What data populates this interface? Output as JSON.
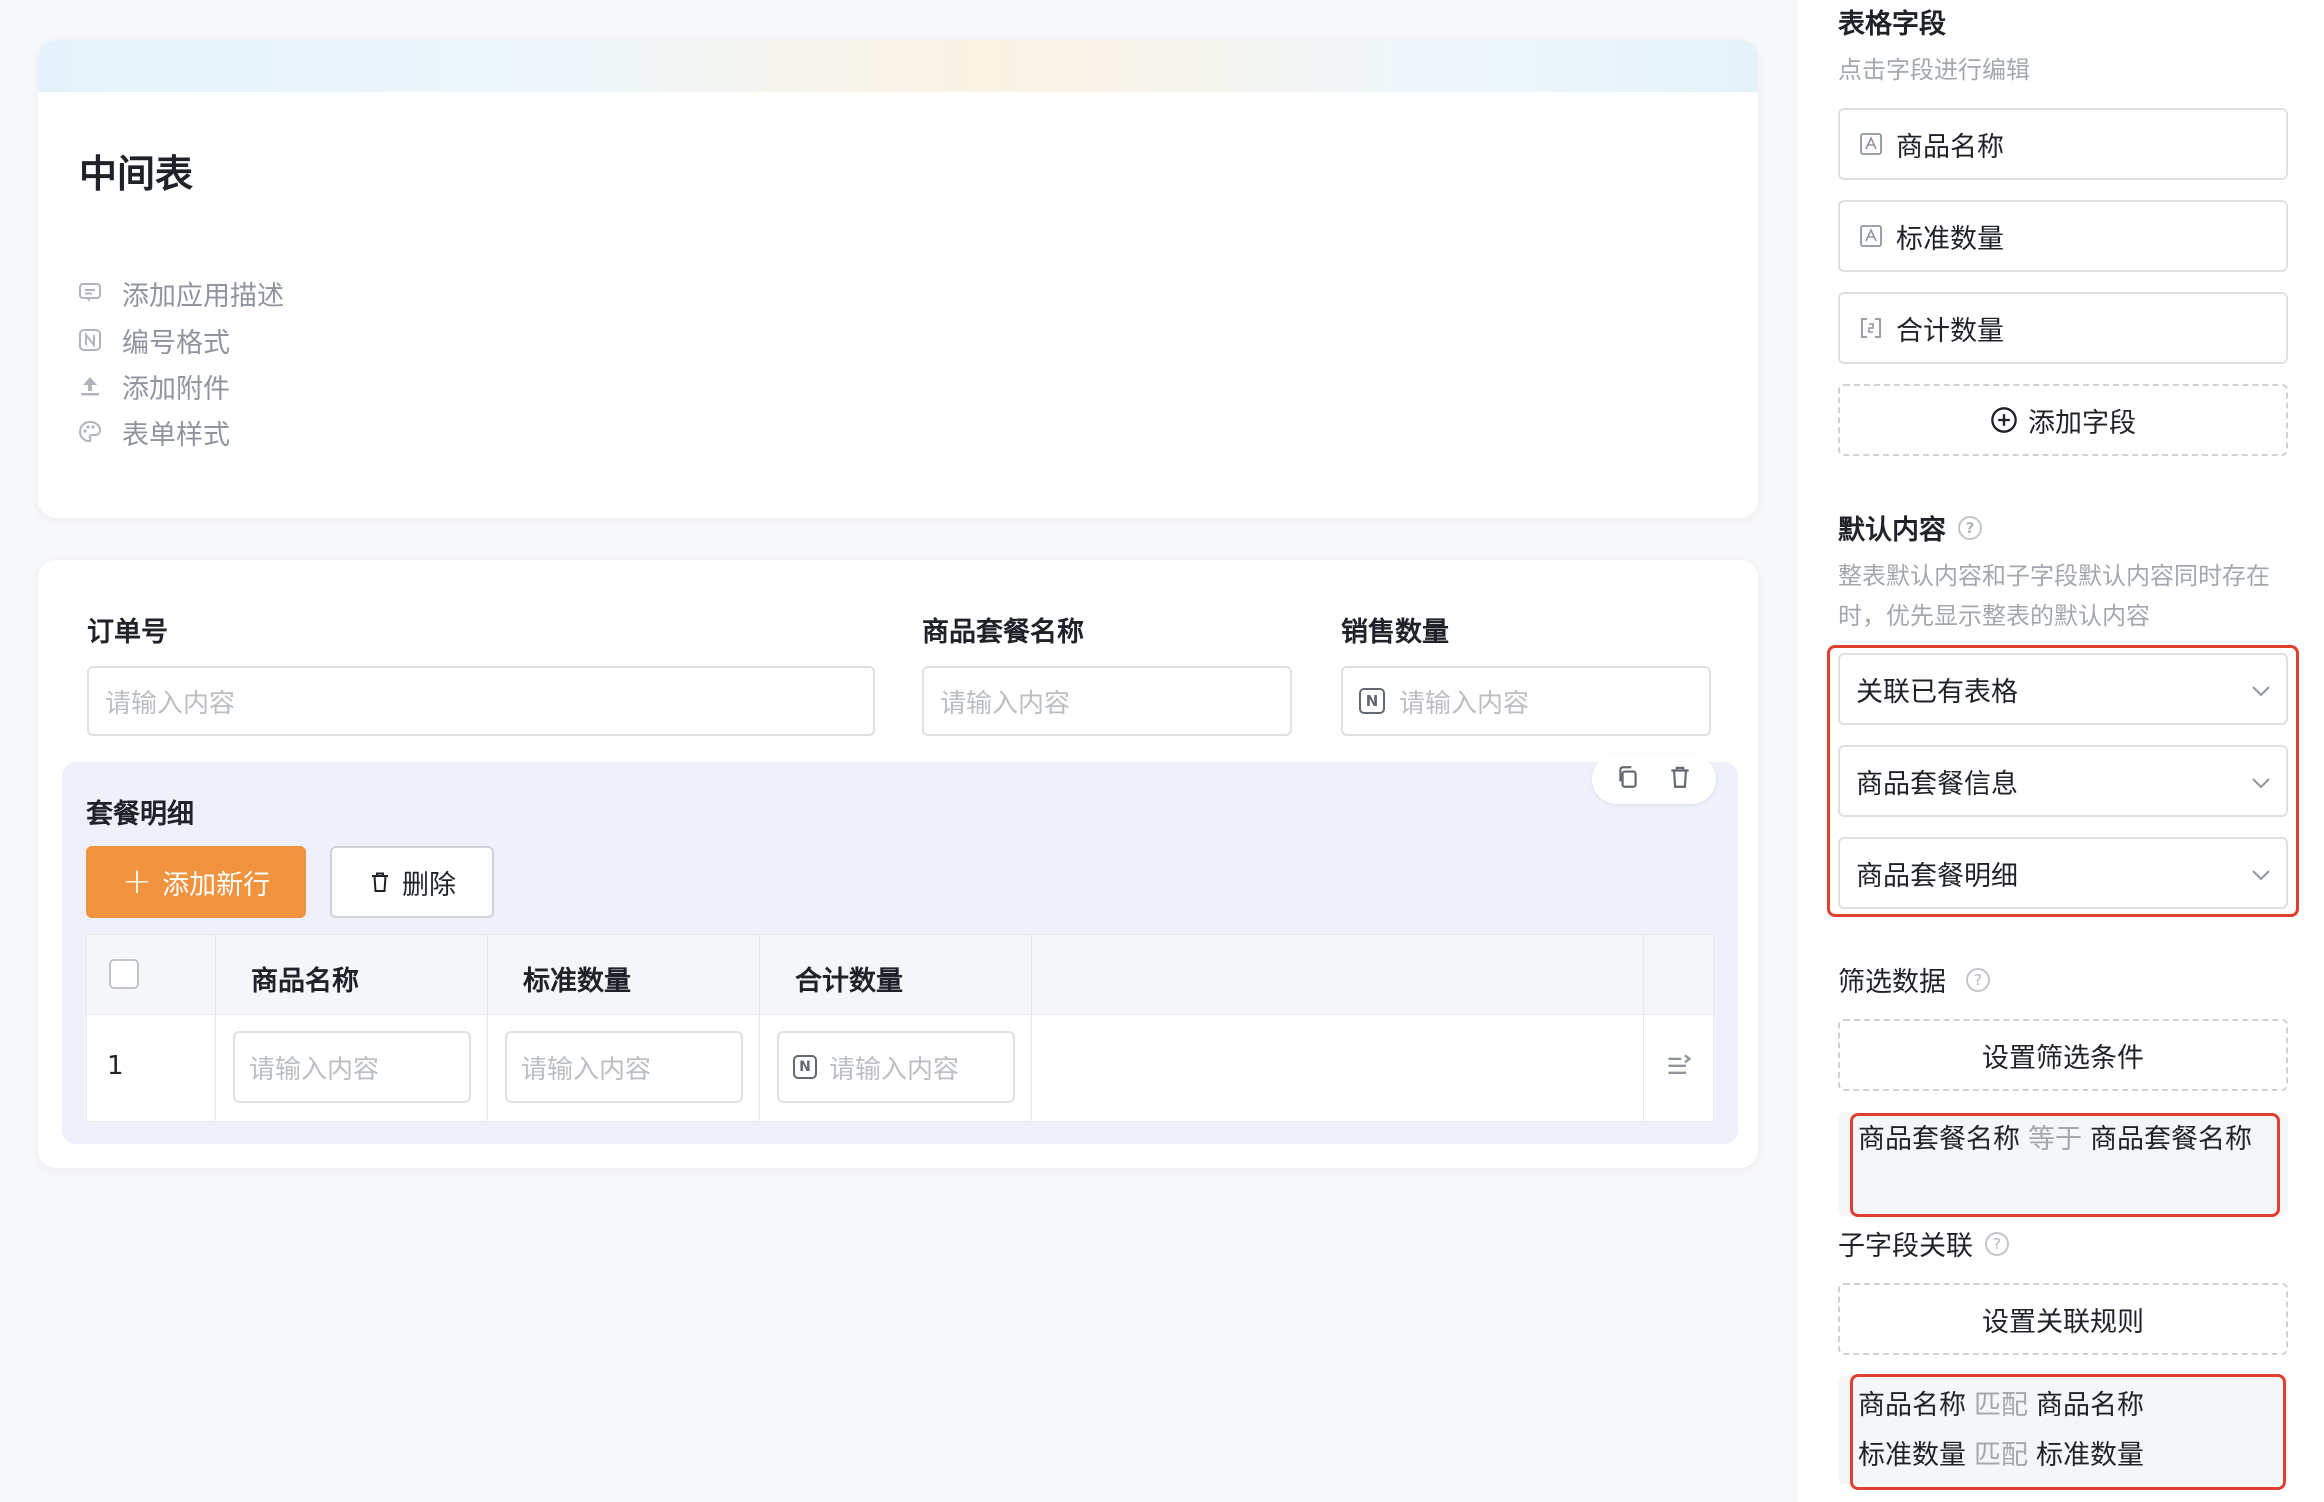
{
  "form": {
    "title": "中间表",
    "meta": [
      {
        "label": "添加应用描述",
        "icon": "comment-icon"
      },
      {
        "label": "编号格式",
        "icon": "number-format-icon"
      },
      {
        "label": "添加附件",
        "icon": "upload-icon"
      },
      {
        "label": "表单样式",
        "icon": "palette-icon"
      }
    ]
  },
  "fields": {
    "order_no": {
      "label": "订单号",
      "placeholder": "请输入内容"
    },
    "package_name": {
      "label": "商品套餐名称",
      "placeholder": "请输入内容"
    },
    "sales_qty": {
      "label": "销售数量",
      "placeholder": "请输入内容"
    }
  },
  "subtable": {
    "title": "套餐明细",
    "add_row_label": "添加新行",
    "delete_label": "删除",
    "columns": [
      "商品名称",
      "标准数量",
      "合计数量"
    ],
    "rows": [
      {
        "index": "1",
        "cells": [
          "请输入内容",
          "请输入内容",
          "请输入内容"
        ]
      }
    ]
  },
  "panel": {
    "table_fields_title": "表格字段",
    "table_fields_hint": "点击字段进行编辑",
    "table_fields": [
      "商品名称",
      "标准数量",
      "合计数量"
    ],
    "add_field_label": "添加字段",
    "default_content_title": "默认内容",
    "default_content_hint": "整表默认内容和子字段默认内容同时存在时，优先显示整表的默认内容",
    "selects": [
      "关联已有表格",
      "商品套餐信息",
      "商品套餐明细"
    ],
    "filter_title": "筛选数据",
    "set_filter_label": "设置筛选条件",
    "filter_condition": {
      "left": "商品套餐名称",
      "op": "等于",
      "right": "商品套餐名称"
    },
    "link_title": "子字段关联",
    "set_link_label": "设置关联规则",
    "link_rules": [
      {
        "left": "商品名称",
        "op": "匹配",
        "right": "商品名称"
      },
      {
        "left": "标准数量",
        "op": "匹配",
        "right": "标准数量"
      }
    ]
  },
  "colors": {
    "accent": "#f0923e",
    "highlight": "#e0402f",
    "subtable_bg": "#eef1fb"
  }
}
